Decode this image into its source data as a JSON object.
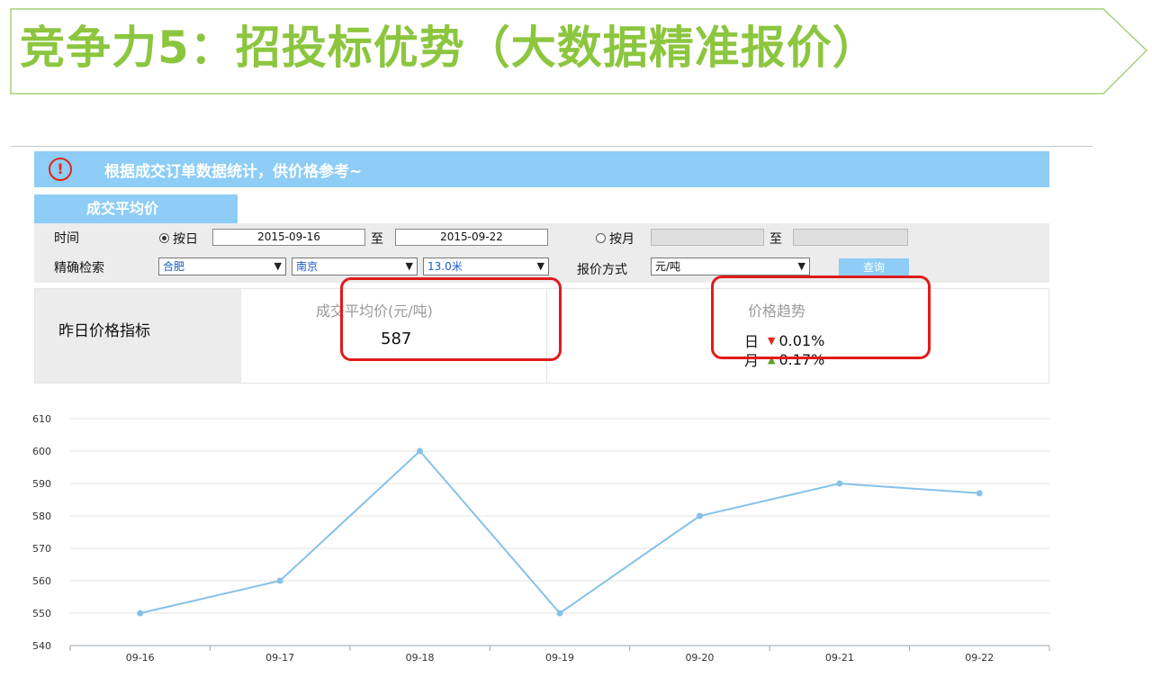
{
  "banner": {
    "title": "竞争力5：招投标优势（大数据精准报价）"
  },
  "notice": {
    "icon": "alert-circle-icon",
    "text": "根据成交订单数据统计，供价格参考~"
  },
  "tab": {
    "label": "成交平均价"
  },
  "filters": {
    "time_label": "时间",
    "by_day_label": "按日",
    "date_from": "2015-09-16",
    "to_label": "至",
    "date_to": "2015-09-22",
    "by_month_label": "按月",
    "month_from": "",
    "month_to": "",
    "precise_label": "精确检索",
    "city_from": "合肥",
    "city_to": "南京",
    "length": "13.0米",
    "quote_method_label": "报价方式",
    "quote_method": "元/吨",
    "query_label": "查询"
  },
  "indicator": {
    "label": "昨日价格指标",
    "avg_title": "成交平均价(元/吨)",
    "avg_value": "587",
    "trend_title": "价格趋势",
    "day_label": "日",
    "day_change": "0.01%",
    "month_label": "月",
    "month_change": "0.17%",
    "colors": {
      "down": "#e0261b",
      "up": "#5aa02c"
    }
  },
  "chart_data": {
    "type": "line",
    "categories": [
      "09-16",
      "09-17",
      "09-18",
      "09-19",
      "09-20",
      "09-21",
      "09-22"
    ],
    "values": [
      550,
      560,
      600,
      550,
      580,
      590,
      587
    ],
    "ylim": [
      540,
      610
    ],
    "yticks": [
      540,
      550,
      560,
      570,
      580,
      590,
      600,
      610
    ],
    "grid": true,
    "line_color": "#86c1ea"
  }
}
